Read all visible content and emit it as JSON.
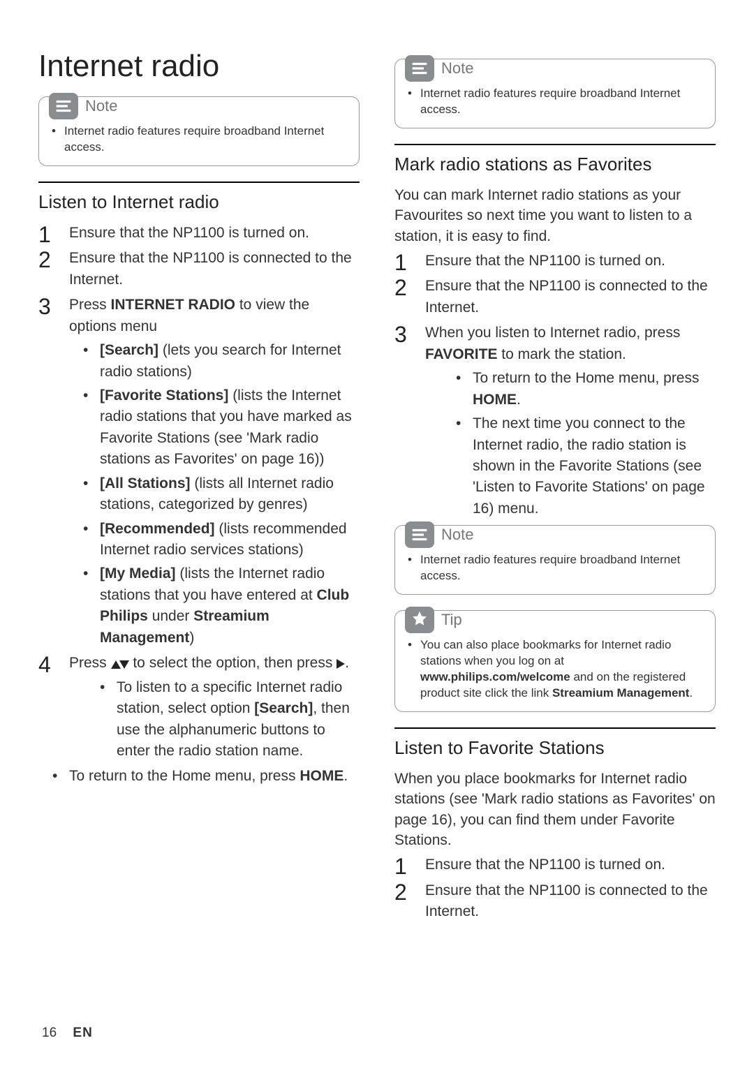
{
  "page": {
    "title": "Internet radio",
    "footer_page": "16",
    "footer_lang": "EN"
  },
  "callouts": {
    "note_label": "Note",
    "tip_label": "Tip",
    "note_body": "Internet radio features require broadband Internet access.",
    "tip_body_pre": "You can also place bookmarks for Internet radio stations when you log on at ",
    "tip_url": "www.philips.com/welcome",
    "tip_body_mid": " and on the registered product site click the link ",
    "tip_link_label": "Streamium Management",
    "tip_body_post": "."
  },
  "left": {
    "section1_title": "Listen to Internet radio",
    "step1": "Ensure that the NP1100 is turned on.",
    "step2": "Ensure that the NP1100 is connected to the Internet.",
    "step3_pre": "Press ",
    "step3_bold": "INTERNET RADIO",
    "step3_post": " to view the options menu",
    "opt1_pre": "[Search]",
    "opt1_post": " (lets you search for Internet radio stations)",
    "opt2_pre": "[Favorite Stations]",
    "opt2_post": " (lists the Internet radio stations that you have marked as Favorite Stations (see 'Mark radio stations as Favorites' on page 16))",
    "opt3_pre": "[All Stations]",
    "opt3_post": " (lists all Internet radio stations, categorized by genres)",
    "opt4_pre": "[Recommended]",
    "opt4_post": " (lists recommended Internet radio services stations)",
    "opt5_pre": "[My Media]",
    "opt5_mid1": " (lists the Internet radio stations that you have entered at ",
    "opt5_bold1": "Club Philips",
    "opt5_mid2": " under ",
    "opt5_bold2": "Streamium Management",
    "opt5_post": ")",
    "step4_pre": "Press ",
    "step4_mid": " to select the option, then press ",
    "step4_end": ".",
    "step4_sub_pre": "To listen to a specific Internet radio station, select option ",
    "step4_sub_bold": "[Search]",
    "step4_sub_post": ", then use the alphanumeric buttons to enter the radio station name.",
    "home_pre": "To return to the Home menu, press ",
    "home_bold": "HOME",
    "home_post": "."
  },
  "right": {
    "section_fav_title": "Mark radio stations as Favorites",
    "fav_intro": "You can mark Internet radio stations as your Favourites so next time you want to listen to a station, it is easy to find.",
    "fav_step1": "Ensure that the NP1100 is turned on.",
    "fav_step2": "Ensure that the NP1100 is connected to the Internet.",
    "fav_step3_pre": "When you listen to Internet radio, press ",
    "fav_step3_bold": "FAVORITE",
    "fav_step3_post": " to mark the station.",
    "fav_sub1_pre": "To return to the Home menu, press ",
    "fav_sub1_bold": "HOME",
    "fav_sub1_post": ".",
    "fav_sub2": "The next time you connect to the Internet radio, the radio station is shown in the Favorite Stations (see 'Listen to Favorite Stations' on page 16) menu.",
    "section_listen_title": "Listen to Favorite Stations",
    "listen_intro": "When you place bookmarks for Internet radio stations (see 'Mark radio stations as Favorites' on page 16), you can find them under Favorite Stations.",
    "listen_step1": "Ensure that the NP1100 is turned on.",
    "listen_step2": "Ensure that the NP1100 is connected to the Internet."
  }
}
